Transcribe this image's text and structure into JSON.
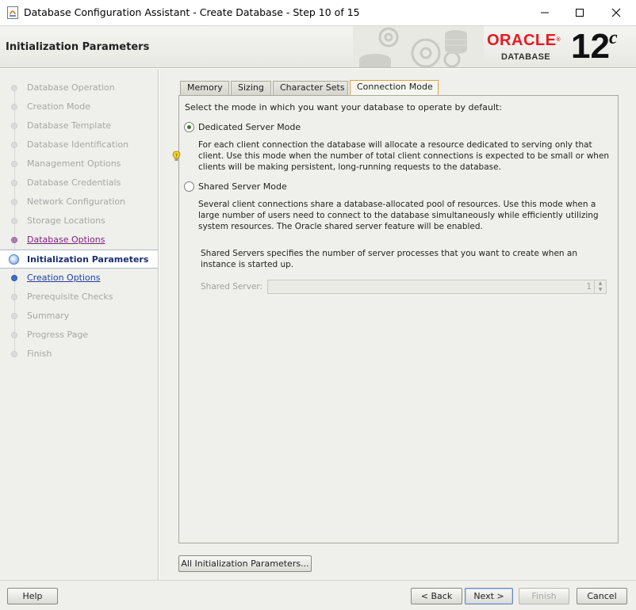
{
  "window": {
    "title": "Database Configuration Assistant - Create Database - Step 10 of 15"
  },
  "header": {
    "page_title": "Initialization Parameters",
    "brand": "ORACLE",
    "brand_sub": "DATABASE",
    "version": "12",
    "version_suffix": "c"
  },
  "steps": [
    {
      "label": "Database Operation",
      "state": "done"
    },
    {
      "label": "Creation Mode",
      "state": "done"
    },
    {
      "label": "Database Template",
      "state": "done"
    },
    {
      "label": "Database Identification",
      "state": "done"
    },
    {
      "label": "Management Options",
      "state": "done"
    },
    {
      "label": "Database Credentials",
      "state": "done"
    },
    {
      "label": "Network Configuration",
      "state": "done"
    },
    {
      "label": "Storage Locations",
      "state": "done"
    },
    {
      "label": "Database Options",
      "state": "visited"
    },
    {
      "label": "Initialization Parameters",
      "state": "current"
    },
    {
      "label": "Creation Options",
      "state": "next"
    },
    {
      "label": "Prerequisite Checks",
      "state": "disabled"
    },
    {
      "label": "Summary",
      "state": "disabled"
    },
    {
      "label": "Progress Page",
      "state": "disabled"
    },
    {
      "label": "Finish",
      "state": "disabled"
    }
  ],
  "tabs": [
    {
      "label": "Memory",
      "active": false
    },
    {
      "label": "Sizing",
      "active": false
    },
    {
      "label": "Character Sets",
      "active": false
    },
    {
      "label": "Connection Mode",
      "active": true
    }
  ],
  "connection_mode": {
    "intro": "Select the mode in which you want your database to operate by default:",
    "dedicated": {
      "label": "Dedicated Server Mode",
      "selected": true,
      "description": "For each client connection the database will allocate a resource dedicated to serving only that client.  Use this mode when the number of total client connections is expected to be small or when clients will be making persistent, long-running requests to the database."
    },
    "shared": {
      "label": "Shared Server Mode",
      "selected": false,
      "description": "Several client connections share a database-allocated pool of resources.  Use this mode when a large number of users need to connect to the database simultaneously while efficiently utilizing system resources.  The Oracle shared server feature will be enabled.",
      "servers_help": "Shared Servers specifies the number of server processes that you want to create when an instance is started up.",
      "servers_label": "Shared Server:",
      "servers_value": "1"
    }
  },
  "buttons": {
    "all_params": "All Initialization Parameters...",
    "help": "Help",
    "back": "< Back",
    "next": "Next >",
    "finish": "Finish",
    "cancel": "Cancel"
  },
  "colors": {
    "oracle_red": "#e31b23",
    "visited_link": "#7d1f7d",
    "next_link": "#1f3fa6",
    "active_tab_border": "#e0a040"
  }
}
